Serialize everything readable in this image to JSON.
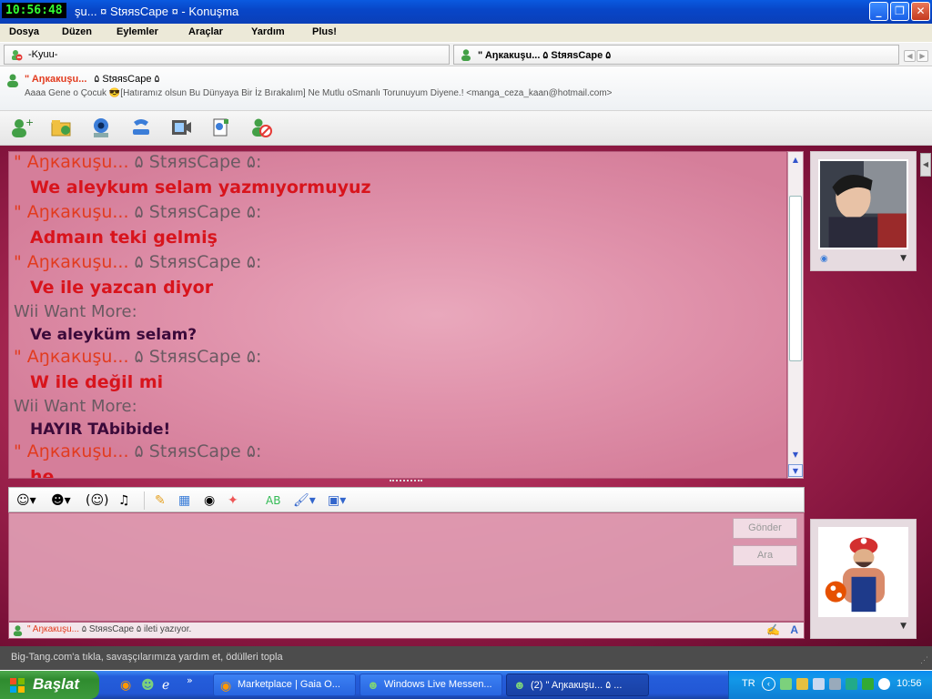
{
  "window": {
    "clock_overlay": "10:56:48",
    "title": "şu...  ¤  StяяsCape ¤  - Konuşma",
    "minimize": "_",
    "maximize": "❐",
    "close": "✕"
  },
  "menu": [
    "Dosya",
    "Düzen",
    "Eylemler",
    "Araçlar",
    "Yardım",
    "Plus!"
  ],
  "tabs": [
    {
      "label": "-Kyuu-"
    },
    {
      "label": "\" Aŋкакuşu...  ۵  StяяsCape ۵"
    }
  ],
  "contact": {
    "name": "\" Aŋкакuşu...",
    "name_suffix": "۵  StяяsCape ۵",
    "personal_message": "Aaaa Gene o Çocuk 😎[Hatıramız olsun Bu Dünyaya Bir İz Bırakalım] Ne Mutlu oSmanlı Torunuyum Diyene.! <manga_ceza_kaan@hotmail.com>"
  },
  "toolbar_icons": [
    "invite-contact-icon",
    "send-files-icon",
    "video-call-icon",
    "call-icon",
    "video-clip-icon",
    "activities-icon",
    "block-contact-icon"
  ],
  "conversation": [
    {
      "type": "sender",
      "a": "\" Aŋкакuşu...",
      "b": "  ۵  StяяsCape ۵:"
    },
    {
      "type": "msg",
      "text": "We aleykum selam yazmıyormuyuz"
    },
    {
      "type": "sender",
      "a": "\" Aŋкакuşu...",
      "b": "  ۵  StяяsCape ۵:"
    },
    {
      "type": "msg",
      "text": "Admaın teki gelmiş"
    },
    {
      "type": "sender",
      "a": "\" Aŋкакuşu...",
      "b": "  ۵  StяяsCape ۵:"
    },
    {
      "type": "msg",
      "text": "Ve ile yazcan diyor"
    },
    {
      "type": "sender-wii",
      "text": "Wii Want More:"
    },
    {
      "type": "msg-wii",
      "text": "Ve aleyküm selam?"
    },
    {
      "type": "sender",
      "a": "\" Aŋкакuşu...",
      "b": "  ۵  StяяsCape ۵:"
    },
    {
      "type": "msg",
      "text": "W ile değil mi"
    },
    {
      "type": "sender-wii",
      "text": "Wii Want More:"
    },
    {
      "type": "msg-wii",
      "text": "HAYIR TAbibide!"
    },
    {
      "type": "sender",
      "a": "\" Aŋкакuşu...",
      "b": "  ۵  StяяsCape ۵:"
    },
    {
      "type": "msg",
      "text": "he"
    }
  ],
  "input_tools": [
    "emoticon-icon",
    "wink-icon",
    "nudge-icon",
    "voice-clip-icon",
    "ink-icon",
    "backgrounds-icon",
    "sound-icon",
    "games-icon",
    "font-icon",
    "paint-icon",
    "picture-icon"
  ],
  "buttons": {
    "send": "Gönder",
    "search": "Ara"
  },
  "typing_status": {
    "who": "\" Aŋкакuşu...",
    "rest": " ۵ StяяsCape ۵ ileti yazıyor."
  },
  "ad_text": "Big-Tang.com'a tıkla, savaşçılarımıza yardım et, ödülleri topla",
  "taskbar": {
    "start": "Başlat",
    "tasks": [
      {
        "label": "Marketplace | Gaia O..."
      },
      {
        "label": "Windows Live Messen..."
      },
      {
        "label": "(2) \" Aŋкакuşu...  ۵ ..."
      }
    ],
    "language": "TR",
    "time": "10:56"
  },
  "colors": {
    "sender_name": "#e23b1e",
    "message_red": "#d8141c",
    "message_wii": "#3b0a3a",
    "background_pink": "#a42550"
  }
}
